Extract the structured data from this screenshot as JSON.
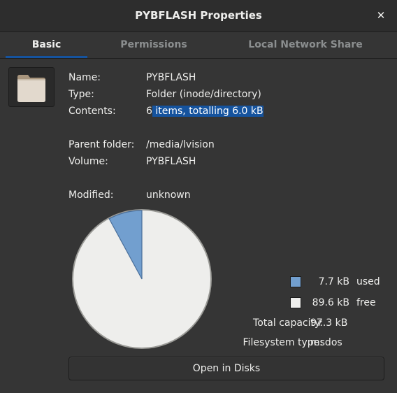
{
  "window": {
    "title": "PYBFLASH Properties",
    "close_glyph": "✕"
  },
  "tabs": [
    {
      "label": "Basic",
      "active": true
    },
    {
      "label": "Permissions",
      "active": false
    },
    {
      "label": "Local Network Share",
      "active": false
    }
  ],
  "icon": "folder-icon",
  "info": {
    "name_label": "Name:",
    "name_value": "PYBFLASH",
    "type_label": "Type:",
    "type_value": "Folder (inode/directory)",
    "contents_label": "Contents:",
    "contents_value_pre": "6",
    "contents_value_sel": " items, totalling 6.0 kB",
    "parent_label": "Parent folder:",
    "parent_value": "/media/lvision",
    "volume_label": "Volume:",
    "volume_value": "PYBFLASH",
    "modified_label": "Modified:",
    "modified_value": "unknown"
  },
  "usage": {
    "used_size": "7.7 kB",
    "used_label": "used",
    "free_size": "89.6 kB",
    "free_label": "free",
    "used_fraction": 0.0792,
    "used_color": "#729fcf",
    "free_color": "#eeeeec"
  },
  "capacity": {
    "total_label": "Total capacity:",
    "total_value": "97.3 kB",
    "fs_label": "Filesystem type:",
    "fs_value": "msdos"
  },
  "actions": {
    "open_disks": "Open in Disks"
  }
}
